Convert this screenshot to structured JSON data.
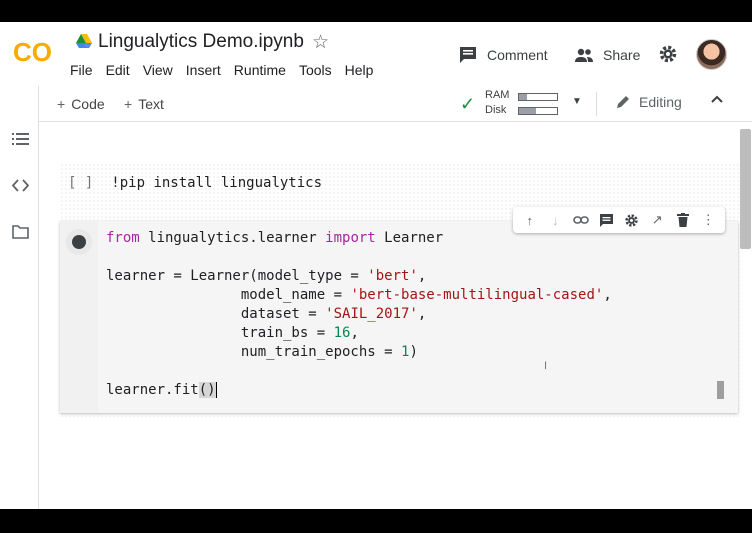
{
  "app": {
    "logo_text": "CO",
    "title": "Lingualytics Demo.ipynb"
  },
  "menu": [
    "File",
    "Edit",
    "View",
    "Insert",
    "Runtime",
    "Tools",
    "Help"
  ],
  "header_actions": {
    "comment": "Comment",
    "share": "Share"
  },
  "toolbar": {
    "add_code": "Code",
    "add_text": "Text",
    "ram_label": "RAM",
    "disk_label": "Disk",
    "ram_usage": 0.2,
    "disk_usage": 0.45,
    "mode": "Editing"
  },
  "cells": {
    "cell1_bracket": "[ ]",
    "cell1_code": "!pip install lingualytics"
  },
  "colors": {
    "accent_orange": "#f9ab00",
    "check_green": "#1e8e3e",
    "keyword": "#a626a4",
    "string": "#a31515",
    "number": "#098658"
  }
}
